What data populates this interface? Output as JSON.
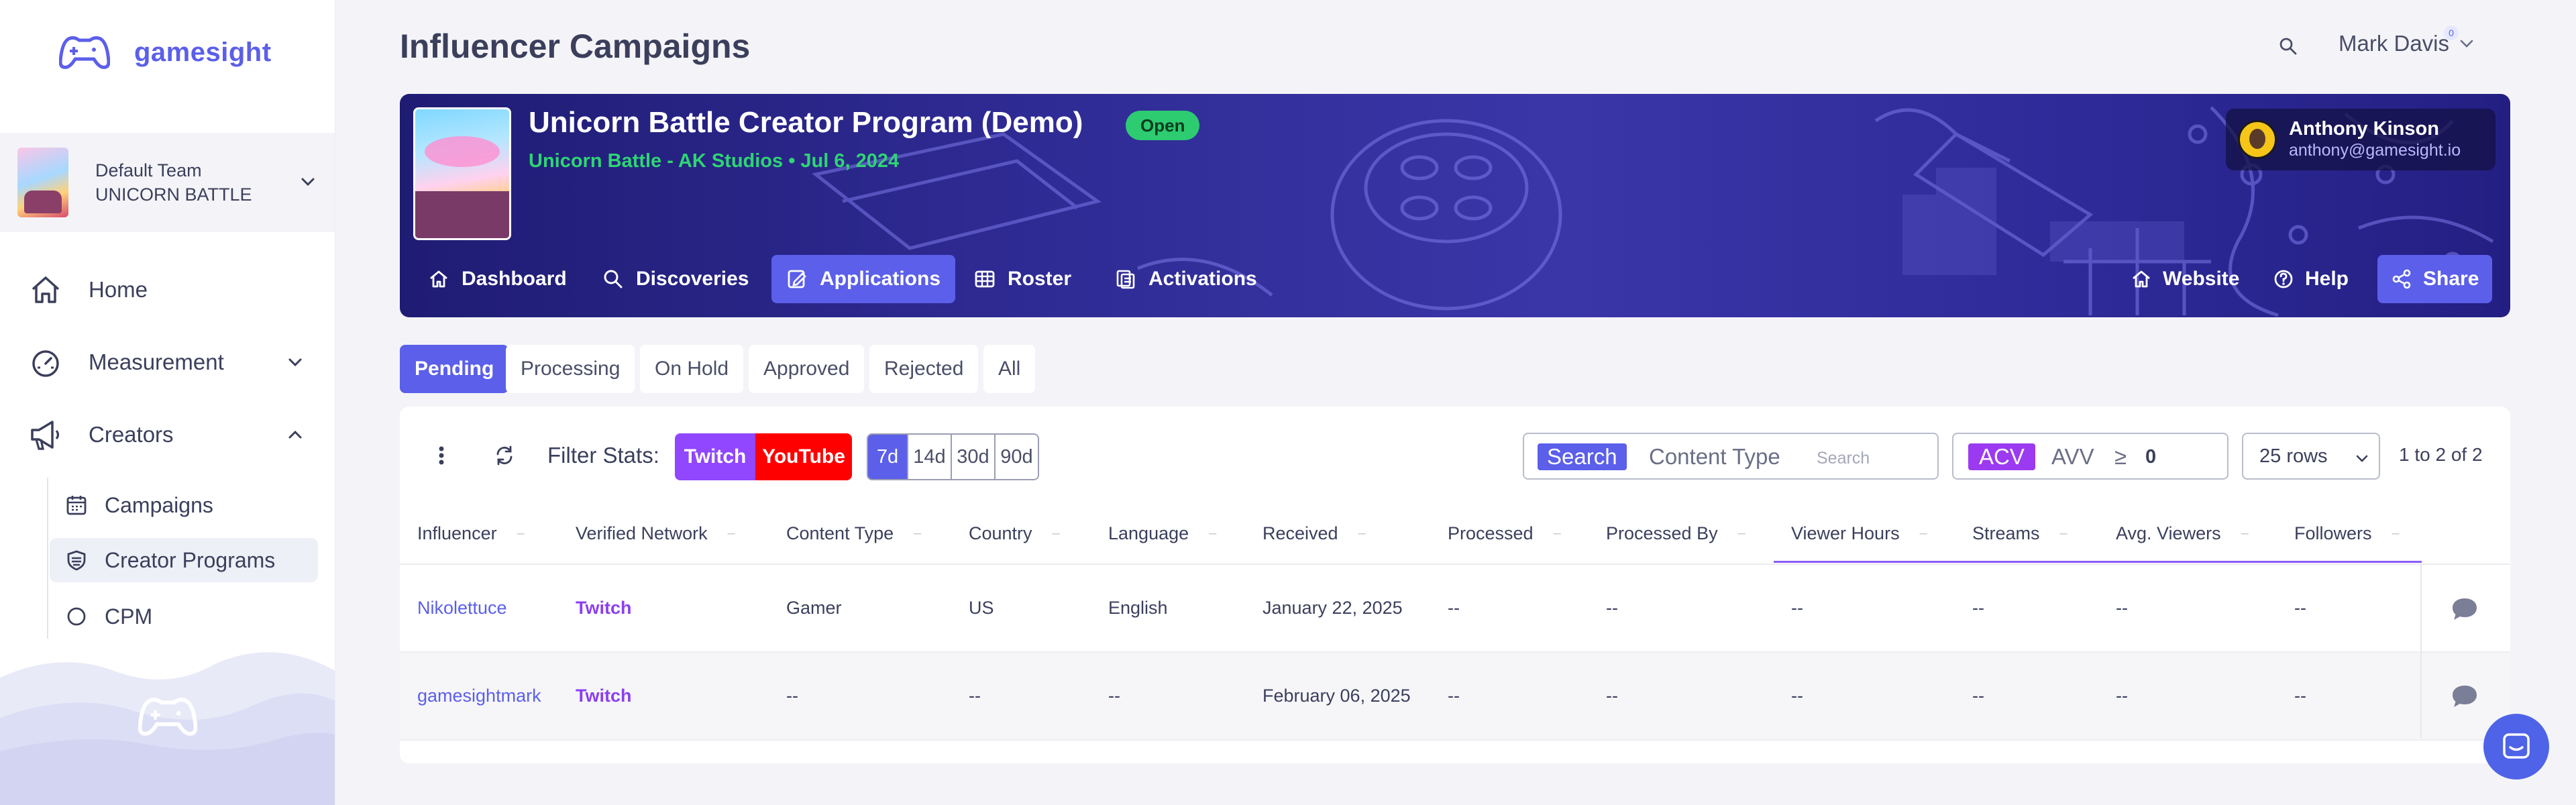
{
  "brand": {
    "name": "gamesight"
  },
  "team": {
    "line1": "Default Team",
    "line2": "UNICORN BATTLE"
  },
  "nav": {
    "home": "Home",
    "measurement": "Measurement",
    "creators": "Creators",
    "sub": [
      "Campaigns",
      "Creator Programs",
      "CPM"
    ]
  },
  "header": {
    "title": "Influencer Campaigns",
    "user": "Mark Davis",
    "notif_count": "0"
  },
  "program": {
    "title": "Unicorn Battle Creator Program (Demo)",
    "status": "Open",
    "subtitle": "Unicorn Battle - AK Studios • Jul 6, 2024",
    "owner_name": "Anthony Kinson",
    "owner_email": "anthony@gamesight.io",
    "tabs": [
      "Dashboard",
      "Discoveries",
      "Applications",
      "Roster",
      "Activations"
    ],
    "active_tab": "Applications",
    "actions": [
      "Website",
      "Help",
      "Share"
    ]
  },
  "status_tabs": [
    "Pending",
    "Processing",
    "On Hold",
    "Approved",
    "Rejected",
    "All"
  ],
  "active_status": "Pending",
  "toolbar": {
    "filter_label": "Filter Stats:",
    "platforms": [
      "Twitch",
      "YouTube"
    ],
    "ranges": [
      "7d",
      "14d",
      "30d",
      "90d"
    ],
    "active_range": "7d",
    "search_button": "Search",
    "search_scope": "Content Type",
    "search_placeholder": "Search",
    "metric_acv": "ACV",
    "metric_avv": "AVV",
    "metric_op": "≥",
    "metric_value": "0",
    "rows": "25 rows",
    "pager": "1 to 2 of 2"
  },
  "colors": {
    "accent": "#5b5fe9",
    "twitch": "#9146ff",
    "youtube": "#ff0000",
    "open": "#2ecc71"
  },
  "table": {
    "columns": [
      "Influencer",
      "Verified Network",
      "Content Type",
      "Country",
      "Language",
      "Received",
      "Processed",
      "Processed By",
      "Viewer Hours",
      "Streams",
      "Avg. Viewers",
      "Followers"
    ],
    "rows": [
      [
        "Nikolettuce",
        "Twitch",
        "Gamer",
        "US",
        "English",
        "January 22, 2025",
        "--",
        "--",
        "--",
        "--",
        "--",
        "--"
      ],
      [
        "gamesightmark",
        "Twitch",
        "--",
        "--",
        "--",
        "February 06, 2025",
        "--",
        "--",
        "--",
        "--",
        "--",
        "--"
      ]
    ]
  }
}
